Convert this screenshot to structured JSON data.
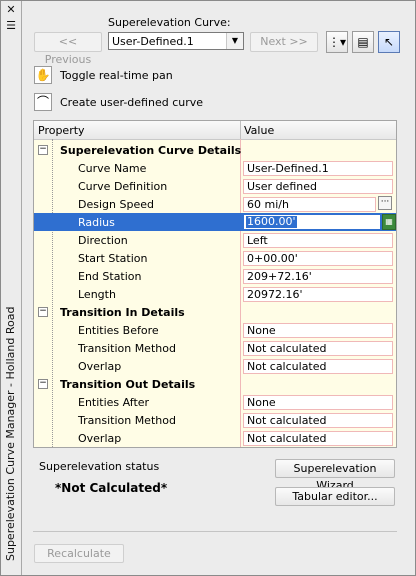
{
  "window": {
    "title": "Superelevation Curve Manager - Holland Road"
  },
  "nav": {
    "curve_label": "Superelevation Curve:",
    "previous_label": "<< Previous",
    "next_label": "Next >>",
    "selected_curve": "User-Defined.1"
  },
  "actions": {
    "toggle_pan": "Toggle real-time pan",
    "create_curve": "Create user-defined curve"
  },
  "grid": {
    "headers": {
      "property": "Property",
      "value": "Value"
    },
    "sections": [
      {
        "title": "Superelevation Curve Details",
        "rows": [
          {
            "prop": "Curve Name",
            "value": "User-Defined.1"
          },
          {
            "prop": "Curve Definition",
            "value": "User defined"
          },
          {
            "prop": "Design Speed",
            "value": "60 mi/h"
          },
          {
            "prop": "Radius",
            "value": "1600.00'"
          },
          {
            "prop": "Direction",
            "value": "Left"
          },
          {
            "prop": "Start Station",
            "value": "0+00.00'"
          },
          {
            "prop": "End Station",
            "value": "209+72.16'"
          },
          {
            "prop": "Length",
            "value": "20972.16'"
          }
        ]
      },
      {
        "title": "Transition In Details",
        "rows": [
          {
            "prop": "Entities Before",
            "value": "None"
          },
          {
            "prop": "Transition Method",
            "value": "Not calculated"
          },
          {
            "prop": "Overlap",
            "value": "Not calculated"
          }
        ]
      },
      {
        "title": "Transition Out Details",
        "rows": [
          {
            "prop": "Entities After",
            "value": "None"
          },
          {
            "prop": "Transition Method",
            "value": "Not calculated"
          },
          {
            "prop": "Overlap",
            "value": "Not calculated"
          }
        ]
      }
    ]
  },
  "status": {
    "label": "Superelevation status",
    "value": "*Not Calculated*"
  },
  "buttons": {
    "wizard": "Superelevation Wizard",
    "tabular": "Tabular editor...",
    "recalculate": "Recalculate"
  },
  "icons": {
    "close": "close-icon",
    "menu": "menu-icon",
    "list_options": "list-options-icon",
    "table_view": "table-view-icon",
    "select_curve": "select-curve-icon",
    "pan": "hand-pan-icon",
    "create_curve": "create-curve-icon",
    "ellipsis": "ellipsis-icon",
    "pick": "pick-in-drawing-icon"
  },
  "colors": {
    "selection": "#2f6fd0",
    "grid_background": "#fffde6",
    "value_border": "#f0b8b8"
  }
}
